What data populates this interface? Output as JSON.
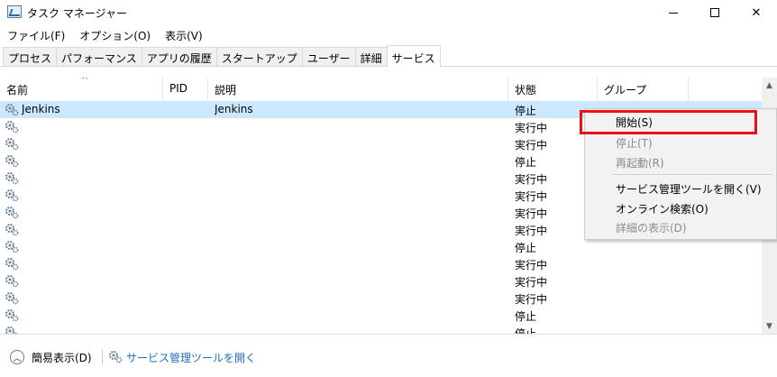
{
  "window": {
    "title": "タスク マネージャー",
    "minimize_glyph": "",
    "close_glyph": "✕"
  },
  "menu": [
    "ファイル(F)",
    "オプション(O)",
    "表示(V)"
  ],
  "tabs": [
    {
      "label": "プロセス",
      "active": false
    },
    {
      "label": "パフォーマンス",
      "active": false
    },
    {
      "label": "アプリの履歴",
      "active": false
    },
    {
      "label": "スタートアップ",
      "active": false
    },
    {
      "label": "ユーザー",
      "active": false
    },
    {
      "label": "詳細",
      "active": false
    },
    {
      "label": "サービス",
      "active": true
    }
  ],
  "table": {
    "sort_indicator": "^",
    "columns": [
      "名前",
      "PID",
      "説明",
      "状態",
      "グループ"
    ],
    "rows": [
      {
        "name": "Jenkins",
        "pid": "",
        "description": "Jenkins",
        "status": "停止",
        "group": "",
        "selected": true
      },
      {
        "name": "",
        "pid": "",
        "description": "",
        "status": "実行中",
        "group": ""
      },
      {
        "name": "",
        "pid": "",
        "description": "",
        "status": "実行中",
        "group": ""
      },
      {
        "name": "",
        "pid": "",
        "description": "",
        "status": "停止",
        "group": ""
      },
      {
        "name": "",
        "pid": "",
        "description": "",
        "status": "実行中",
        "group": ""
      },
      {
        "name": "",
        "pid": "",
        "description": "",
        "status": "実行中",
        "group": ""
      },
      {
        "name": "",
        "pid": "",
        "description": "",
        "status": "実行中",
        "group": ""
      },
      {
        "name": "",
        "pid": "",
        "description": "",
        "status": "実行中",
        "group": ""
      },
      {
        "name": "",
        "pid": "",
        "description": "",
        "status": "停止",
        "group": ""
      },
      {
        "name": "",
        "pid": "",
        "description": "",
        "status": "実行中",
        "group": ""
      },
      {
        "name": "",
        "pid": "",
        "description": "",
        "status": "実行中",
        "group": ""
      },
      {
        "name": "",
        "pid": "",
        "description": "",
        "status": "実行中",
        "group": ""
      },
      {
        "name": "",
        "pid": "",
        "description": "",
        "status": "停止",
        "group": ""
      },
      {
        "name": "",
        "pid": "",
        "description": "",
        "status": "停止",
        "group": ""
      }
    ]
  },
  "context_menu": {
    "items": [
      {
        "label": "開始(S)",
        "enabled": true
      },
      {
        "label": "停止(T)",
        "enabled": false
      },
      {
        "label": "再起動(R)",
        "enabled": false
      },
      {
        "label": "サービス管理ツールを開く(V)",
        "enabled": true
      },
      {
        "label": "オンライン検索(O)",
        "enabled": true
      },
      {
        "label": "詳細の表示(D)",
        "enabled": false
      }
    ],
    "highlight_color": "#e8111a"
  },
  "footer": {
    "fewer_details_label": "簡易表示(D)",
    "open_services_label": "サービス管理ツールを開く",
    "link_color": "#1f6fc5"
  },
  "colors": {
    "selected_row": "#cce8ff"
  },
  "icons": {
    "app": "task-manager-icon",
    "service": "service-gear-icon",
    "collapse": "chevron-up-icon"
  }
}
